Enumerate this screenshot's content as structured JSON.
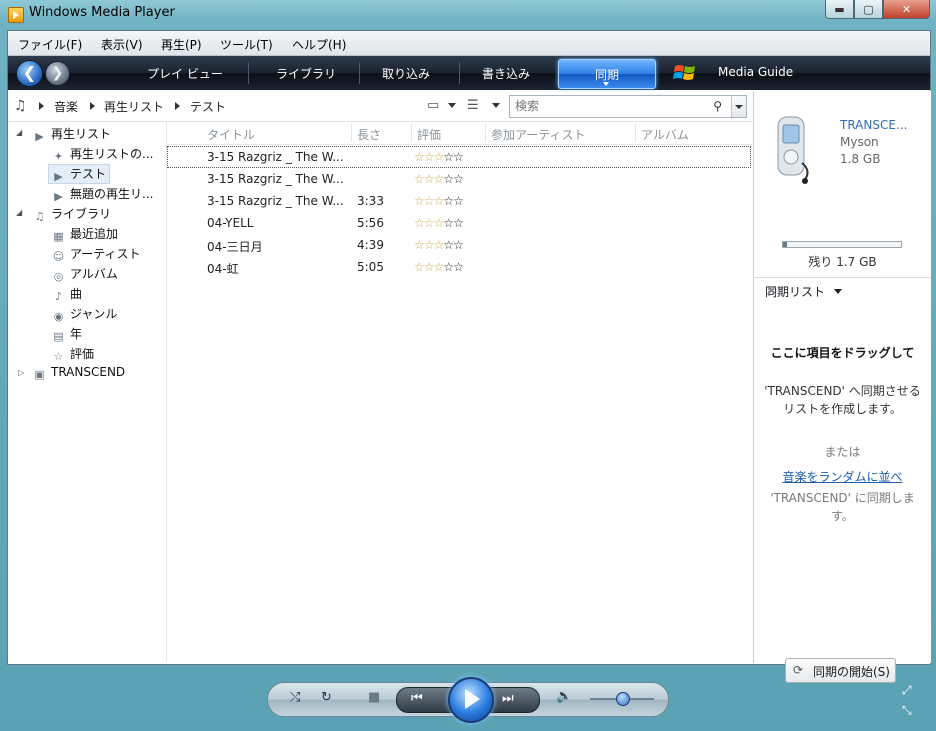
{
  "window": {
    "title": "Windows Media Player",
    "minimize": "▬",
    "maximize": "▢",
    "close": "✕"
  },
  "menu": [
    "ファイル(F)",
    "表示(V)",
    "再生(P)",
    "ツール(T)",
    "ヘルプ(H)"
  ],
  "nav": {
    "back": "❮",
    "forward": "❯",
    "tabs": [
      "プレイ ビュー",
      "ライブラリ",
      "取り込み",
      "書き込み",
      "同期",
      "Media Guide"
    ],
    "active_tab_index": 4
  },
  "breadcrumb": [
    "音楽",
    "再生リスト",
    "テスト"
  ],
  "search": {
    "placeholder": "検索"
  },
  "tree": {
    "playlists": "再生リスト",
    "playlist_items": [
      "再生リストの...",
      "テスト",
      "無題の再生リ..."
    ],
    "library": "ライブラリ",
    "library_items": [
      "最近追加",
      "アーティスト",
      "アルバム",
      "曲",
      "ジャンル",
      "年",
      "評価"
    ],
    "device": "TRANSCEND"
  },
  "columns": [
    "タイトル",
    "長さ",
    "評価",
    "参加アーティスト",
    "アルバム"
  ],
  "tracks": [
    {
      "title": "3-15 Razgriz _ The W...",
      "length": "",
      "rating": 3
    },
    {
      "title": "3-15 Razgriz _ The W...",
      "length": "",
      "rating": 3
    },
    {
      "title": "3-15 Razgriz _ The W...",
      "length": "3:33",
      "rating": 3
    },
    {
      "title": "04-YELL",
      "length": "5:56",
      "rating": 3
    },
    {
      "title": "04-三日月",
      "length": "4:39",
      "rating": 3
    },
    {
      "title": "04-虹",
      "length": "5:05",
      "rating": 3
    }
  ],
  "device": {
    "name": "TRANSCE...",
    "maker": "Myson",
    "capacity": "1.8 GB",
    "used_fraction": 0.03,
    "remaining": "残り 1.7 GB"
  },
  "sync": {
    "list_label": "同期リスト",
    "drag_title": "ここに項目をドラッグして",
    "drag_desc": "'TRANSCEND' へ同期させるリストを作成します。",
    "or": "または",
    "shuffle_link": "音楽をランダムに並べ",
    "shuffle_desc": "'TRANSCEND' に同期します。",
    "start_button": "同期の開始(S)"
  },
  "playback": {
    "shuffle": "⤭",
    "repeat": "↻",
    "stop": "■",
    "prev": "⏮",
    "next": "⏭",
    "volume_icon": "🔈",
    "volume_level": 0.5
  },
  "colors": {
    "accent": "#2f7fe4",
    "link": "#1f5fae",
    "nav_bg": "#1a2230"
  }
}
